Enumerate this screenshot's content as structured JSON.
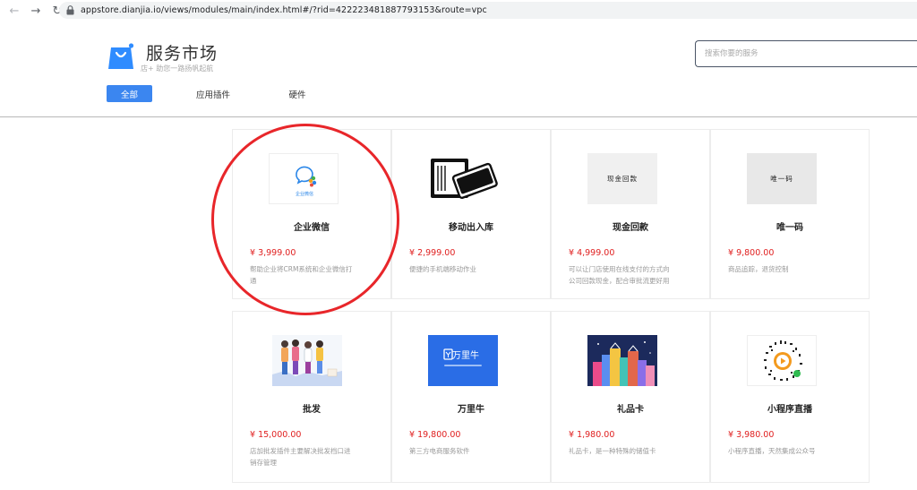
{
  "browser": {
    "url": "appstore.dianjia.io/views/modules/main/index.html#/?rid=422223481887793153&route=vpc"
  },
  "header": {
    "brand_title": "服务市场",
    "brand_slogan": "店+ 助您一路扬帆起航",
    "search_placeholder": "搜索你要的服务",
    "accent_color": "#3b86f0"
  },
  "tabs": [
    {
      "label": "全部",
      "active": true
    },
    {
      "label": "应用插件",
      "active": false
    },
    {
      "label": "硬件",
      "active": false
    }
  ],
  "products": [
    {
      "name": "企业微信",
      "price": "¥ 3,999.00",
      "desc": "帮助企业将CRM系统和企业微信打通",
      "thumb_text": "企业微信",
      "icon": "wework-logo-icon"
    },
    {
      "name": "移动出入库",
      "price": "¥ 2,999.00",
      "desc": "便捷的手机端移动作业",
      "icon": "card-scanner-icon"
    },
    {
      "name": "现金回款",
      "price": "¥ 4,999.00",
      "desc": "可以让门店使用在线支付的方式向公司回款现金，配合审批流更好用",
      "thumb_text": "现金回款",
      "icon": "cash-text-icon"
    },
    {
      "name": "唯一码",
      "price": "¥ 9,800.00",
      "desc": "商品追踪，退货控制",
      "thumb_text": "唯一码",
      "icon": "unique-code-text-icon"
    },
    {
      "name": "批发",
      "price": "¥ 15,000.00",
      "desc": "店加批发插件主要解决批发档口进销存管理",
      "icon": "wholesale-people-icon"
    },
    {
      "name": "万里牛",
      "price": "¥ 19,800.00",
      "desc": "第三方电商服务软件",
      "thumb_text": "万里牛",
      "icon": "wanliniu-logo-icon"
    },
    {
      "name": "礼品卡",
      "price": "¥ 1,980.00",
      "desc": "礼品卡，是一种特殊的储值卡",
      "icon": "gift-card-icon"
    },
    {
      "name": "小程序直播",
      "price": "¥ 3,980.00",
      "desc": "小程序直播，天然集成公众号",
      "icon": "miniprogram-qr-icon"
    }
  ],
  "annotation": {
    "color": "#e8262a"
  }
}
